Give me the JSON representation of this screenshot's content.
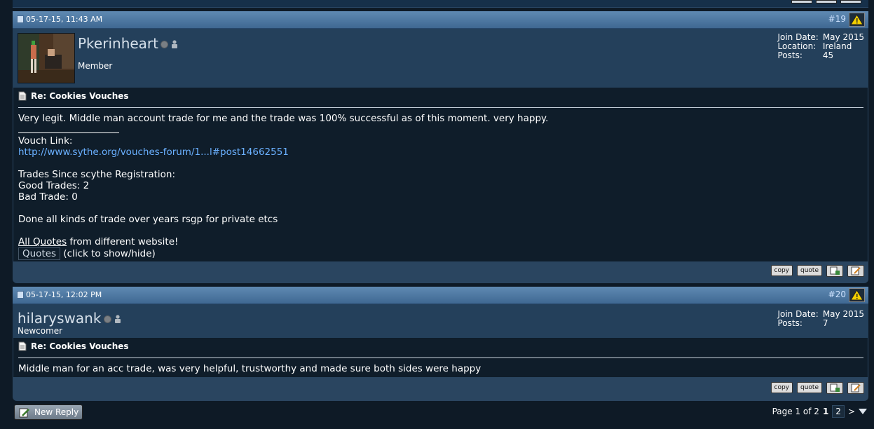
{
  "posts": [
    {
      "date": "05-17-15, 11:43 AM",
      "number": "#19",
      "username": "Pkerinheart",
      "user_title": "Member",
      "info": [
        {
          "label": "Join Date:",
          "value": "May 2015"
        },
        {
          "label": "Location:",
          "value": "Ireland"
        },
        {
          "label": "Posts:",
          "value": "45"
        }
      ],
      "post_title": "Re: Cookies Vouches",
      "lines": {
        "l1": "Very legit. Middle man account trade for me and the trade was 100% successful as of this moment. very happy.",
        "vouch_label": "Vouch Link:",
        "vouch_link": "http://www.sythe.org/vouches-forum/1...l#post14662551",
        "trades_heading": "Trades Since scythe Registration:",
        "good": "Good Trades: 2",
        "bad": "Bad Trade: 0",
        "done": "Done all kinds of trade over years rsgp for private etcs",
        "quotes_link": "All Quotes",
        "quotes_rest": " from different website!",
        "quotes_button": "Quotes",
        "quotes_hint": "(click to show/hide)"
      }
    },
    {
      "date": "05-17-15, 12:02 PM",
      "number": "#20",
      "username": "hilaryswank",
      "user_title": "Newcomer",
      "info": [
        {
          "label": "Join Date:",
          "value": "May 2015"
        },
        {
          "label": "Posts:",
          "value": "7"
        }
      ],
      "post_title": "Re: Cookies Vouches",
      "message": "Middle man for an acc trade, was very helpful, trustworthy and made sure both sides were happy"
    }
  ],
  "buttons": {
    "copy": "copy",
    "quote": "quote"
  },
  "footer": {
    "new_reply": "New Reply",
    "page_label": "Page 1 of 2",
    "page1": "1",
    "page2": "2",
    "next": ">"
  }
}
